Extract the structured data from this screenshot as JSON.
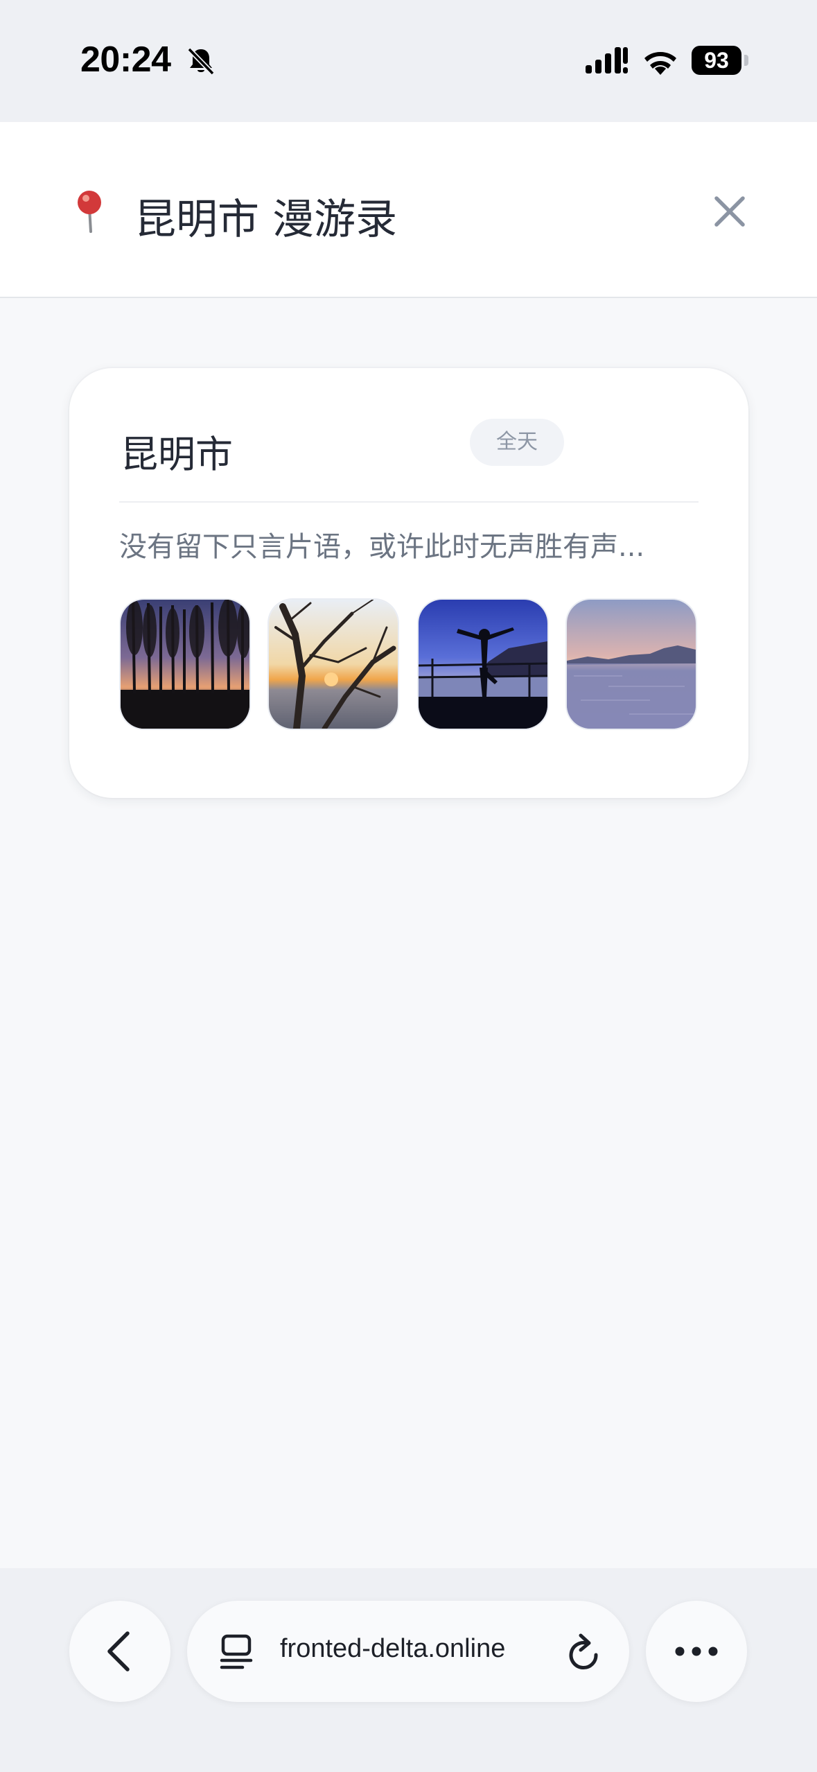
{
  "status_bar": {
    "time": "20:24",
    "battery": "93",
    "icons": [
      "bell-muted-icon",
      "cellular-signal-icon",
      "wifi-icon",
      "battery-icon"
    ]
  },
  "header": {
    "icon": "pin-icon",
    "title": "昆明市 漫游录",
    "close_icon": "close-icon"
  },
  "card": {
    "city": "昆明市",
    "badge": "全天",
    "note": "没有留下只言片语，或许此时无声胜有声...",
    "photos": [
      {
        "subject": "tree-silhouettes-sunset"
      },
      {
        "subject": "bare-tree-sunset-lake"
      },
      {
        "subject": "person-silhouette-railing"
      },
      {
        "subject": "lake-mountains-dusk"
      }
    ]
  },
  "browser_bar": {
    "back_icon": "chevron-left-icon",
    "tabs_icon": "tabs-icon",
    "url": "fronted-delta.online",
    "reload_icon": "reload-icon",
    "more_icon": "more-icon"
  },
  "colors": {
    "background": "#f7f8fa",
    "title_text": "#252a36",
    "muted_text": "#6b7482",
    "badge_bg": "#f1f3f7"
  }
}
